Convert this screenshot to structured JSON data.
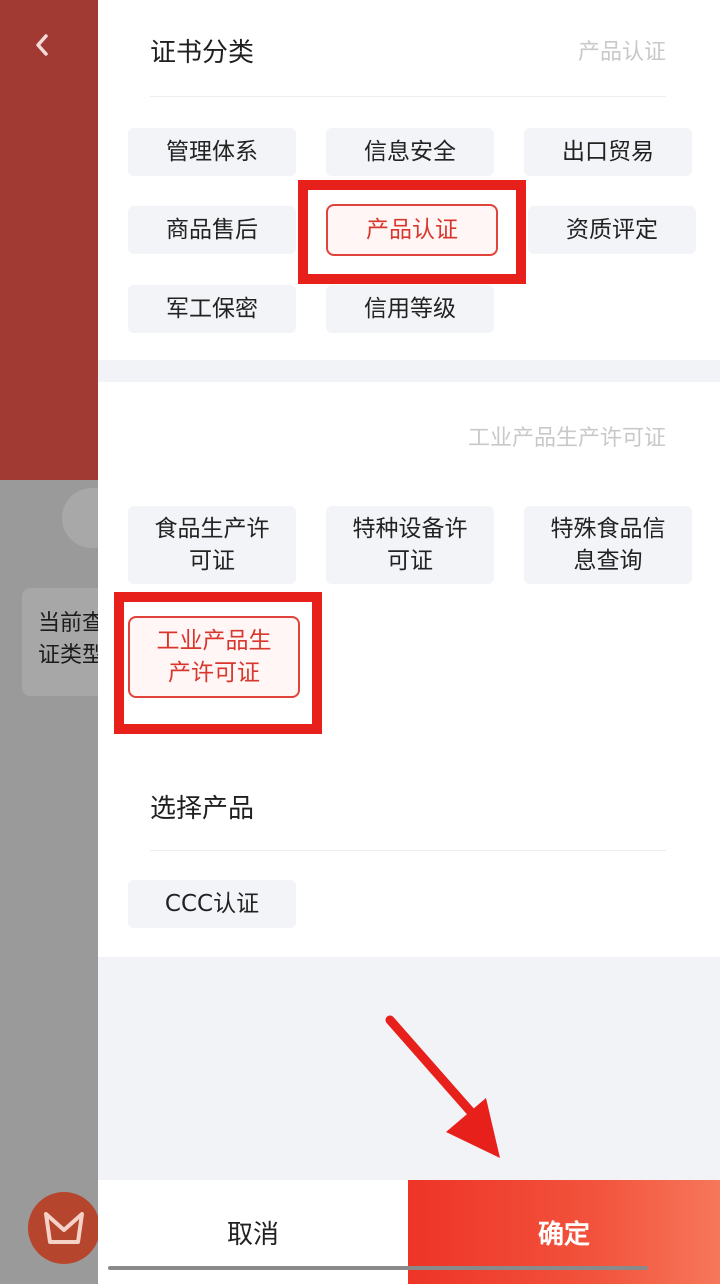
{
  "background": {
    "back_icon": "chevron-left-icon",
    "card_text": "当前查\n证类型",
    "logo_icon": "brand-logo-icon"
  },
  "drawer": {
    "section1": {
      "title": "证书分类",
      "selected_label": "产品认证",
      "chips": [
        "管理体系",
        "信息安全",
        "出口贸易",
        "商品售后",
        "产品认证",
        "资质评定",
        "军工保密",
        "信用等级"
      ],
      "selected_index": 4
    },
    "section2": {
      "selected_label": "工业产品生产许可证",
      "chips": [
        "食品生产许\n可证",
        "特种设备许\n可证",
        "特殊食品信\n息查询",
        "工业产品生\n产许可证"
      ],
      "selected_index": 3
    },
    "section3": {
      "title": "选择产品",
      "chips": [
        "CCC认证"
      ]
    }
  },
  "footer": {
    "cancel_label": "取消",
    "confirm_label": "确定"
  },
  "colors": {
    "accent": "#e0433a",
    "highlight_box": "#e8201c",
    "confirm_start": "#ee3427",
    "confirm_end": "#f6775b"
  }
}
